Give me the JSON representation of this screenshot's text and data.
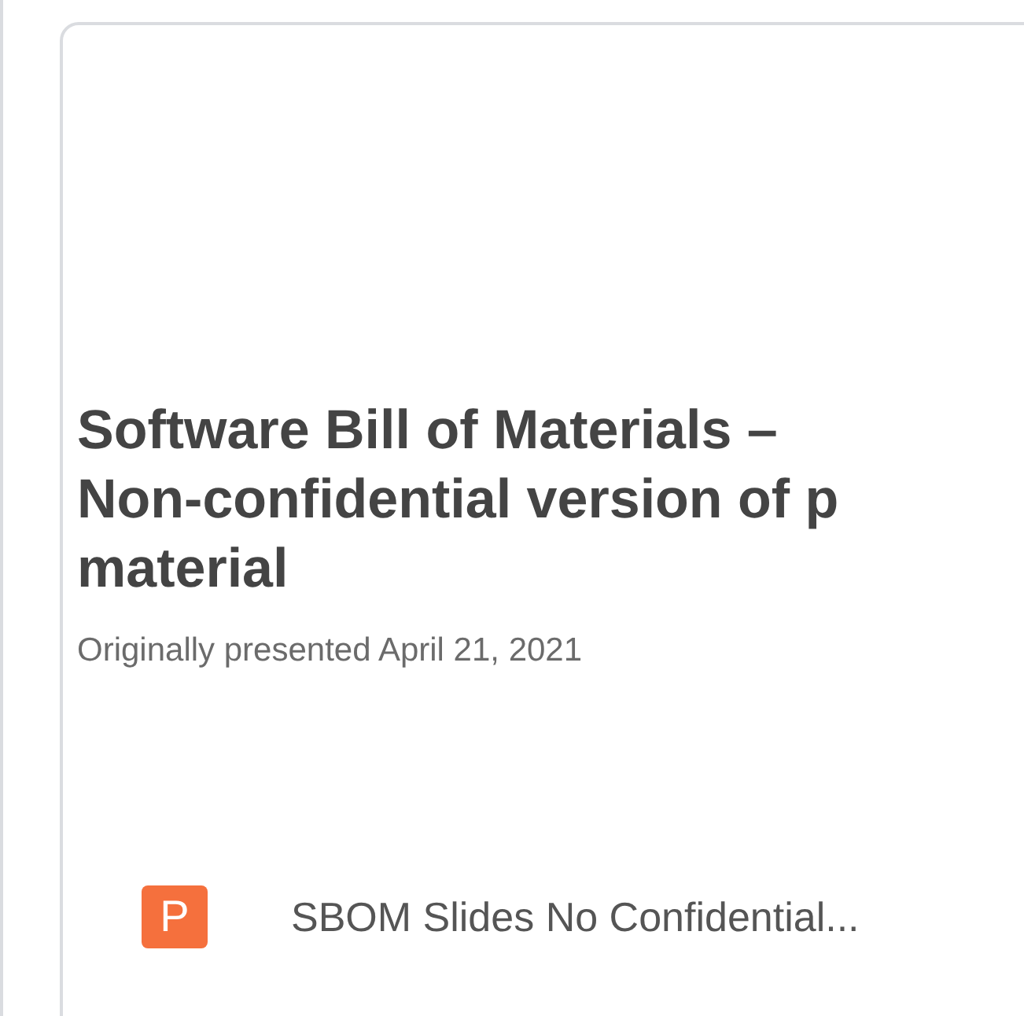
{
  "slide_preview": {
    "title_lines": [
      "Software Bill of Materials –",
      "Non-confidential version of p",
      "material"
    ],
    "subtitle": "Originally presented April 21, 2021"
  },
  "file": {
    "icon_letter": "P",
    "name": "SBOM Slides No Confidential..."
  }
}
